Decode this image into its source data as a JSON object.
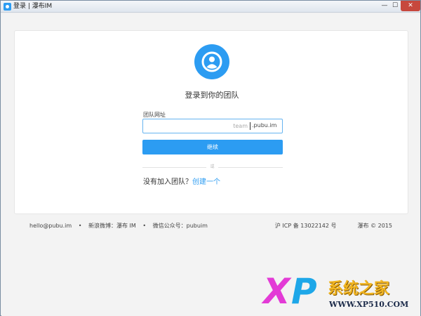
{
  "window": {
    "title": "登录 | 瀑布IM",
    "controls": {
      "minimize": "—",
      "maximize": "☐",
      "close": "✕"
    }
  },
  "login": {
    "heading": "登录到你的团队",
    "field_label": "团队网址",
    "input_placeholder": "team",
    "input_value": "",
    "input_suffix": ".pubu.im",
    "continue_label": "继续",
    "divider_text": "或",
    "no_team_text": "没有加入团队？",
    "create_link": "创建一个",
    "avatar_icon": "user-icon",
    "accent_color": "#2c9cf2"
  },
  "footer": {
    "email": "hello@pubu.im",
    "separator": "•",
    "weibo": "新浪微博：瀑布 IM",
    "wechat": "微信公众号：pubuim",
    "icp": "沪 ICP 备 13022142 号",
    "copyright": "瀑布 © 2015"
  },
  "watermark": {
    "x_letter": "X",
    "p_letter": "P",
    "site_name": "系统之家",
    "site_url": "WWW.XP510.COM"
  }
}
